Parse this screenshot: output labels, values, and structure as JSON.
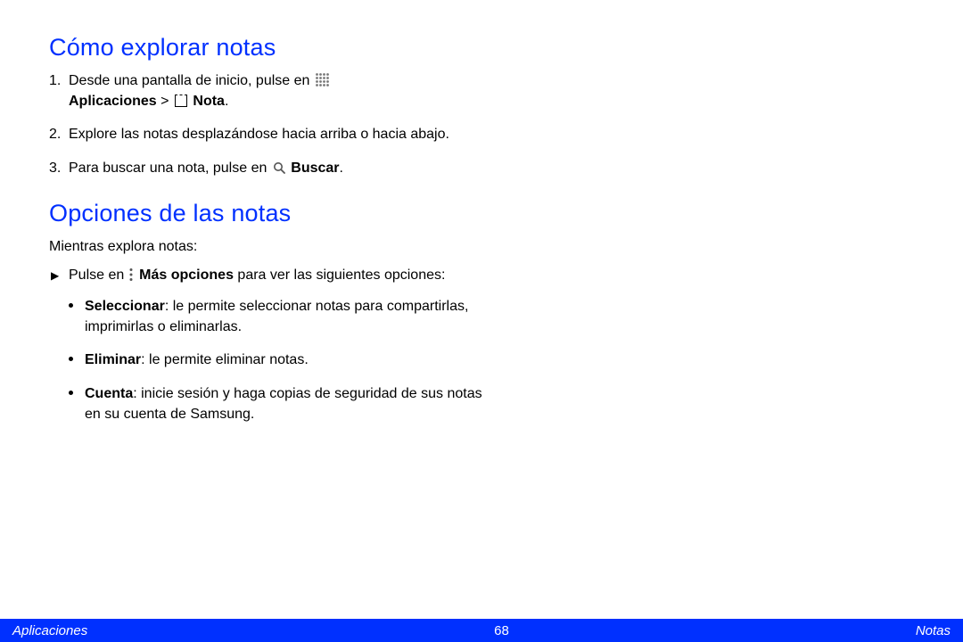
{
  "section1": {
    "heading": "Cómo explorar notas",
    "items": [
      {
        "num": "1.",
        "pre": "Desde una pantalla de inicio, pulse en ",
        "bold1": "Aplicaciones",
        "sep": " > ",
        "bold2": " Nota",
        "post": "."
      },
      {
        "num": "2.",
        "text": "Explore las notas desplazándose hacia arriba o hacia abajo."
      },
      {
        "num": "3.",
        "pre": "Para buscar una nota, pulse en ",
        "bold": " Buscar",
        "post": "."
      }
    ]
  },
  "section2": {
    "heading": "Opciones de las notas",
    "intro": "Mientras explora notas:",
    "lead": {
      "pre": "Pulse en ",
      "bold": " Más opciones",
      "post": " para ver las siguientes opciones:"
    },
    "opts": [
      {
        "bold": "Seleccionar",
        "text": ": le permite seleccionar notas para compartirlas, imprimirlas o eliminarlas."
      },
      {
        "bold": "Eliminar",
        "text": ": le permite eliminar notas."
      },
      {
        "bold": "Cuenta",
        "text": ": inicie sesión y haga copias de seguridad de sus notas en su cuenta de Samsung."
      }
    ]
  },
  "footer": {
    "left": "Aplicaciones",
    "page": "68",
    "right": "Notas"
  }
}
